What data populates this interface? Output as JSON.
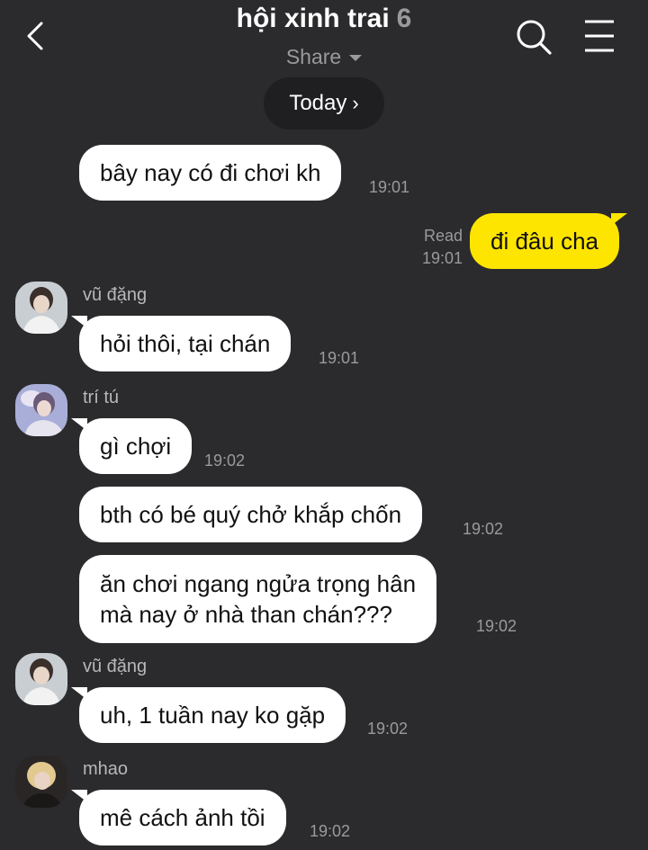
{
  "header": {
    "title": "hội xinh trai",
    "member_count": "6",
    "share_label": "Share",
    "icons": [
      "back-chevron-icon",
      "search-icon",
      "menu-icon"
    ]
  },
  "date_pill": {
    "label": "Today",
    "chevron": "›"
  },
  "colors": {
    "background": "#2b2b2d",
    "my_bubble": "#fee500",
    "their_bubble": "#ffffff",
    "meta_text": "#9a9a9c"
  },
  "messages": [
    {
      "sender": "",
      "text": "bây nay có đi chơi kh",
      "time": "19:01"
    },
    {
      "sender": "me",
      "text": "đi đâu cha",
      "time": "19:01",
      "status": "Read"
    },
    {
      "sender": "vũ đặng",
      "text": "hỏi thôi, tại chán",
      "time": "19:01"
    },
    {
      "sender": "trí tú",
      "text": "gì chợi",
      "time": "19:02"
    },
    {
      "sender": "",
      "text": "bth có bé quý chở khắp chốn",
      "time": "19:02"
    },
    {
      "sender": "",
      "lines": [
        "ăn chơi ngang ngửa trọng hân",
        "mà nay ở nhà than chán???"
      ],
      "time": "19:02"
    },
    {
      "sender": "vũ đặng",
      "text": "uh, 1 tuần nay ko gặp",
      "time": "19:02"
    },
    {
      "sender": "mhao",
      "text": "mê cách ảnh tồi",
      "time": "19:02"
    }
  ]
}
